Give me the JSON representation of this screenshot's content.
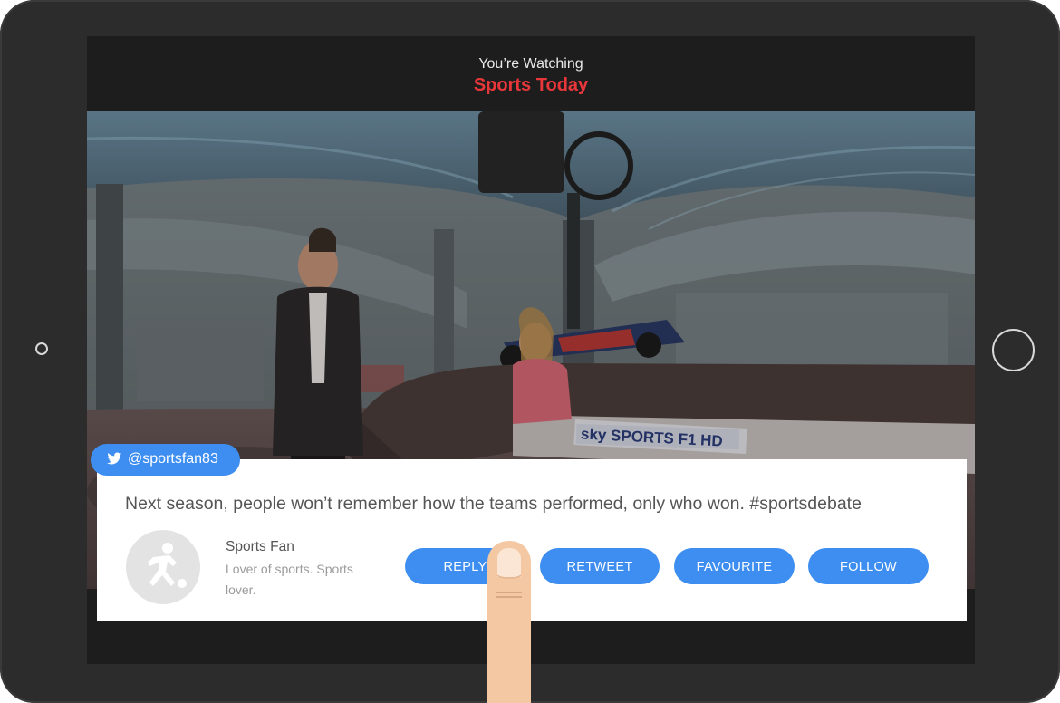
{
  "header": {
    "watching_label": "You’re Watching",
    "show_title": "Sports Today"
  },
  "tweet": {
    "handle": "@sportsfan83",
    "text": "Next season, people won’t remember how the teams performed, only who won. #sportsdebate",
    "user_name": "Sports Fan",
    "user_bio": "Lover of sports. Sports lover."
  },
  "actions": {
    "reply": "REPLY",
    "retweet": "RETWEET",
    "favourite": "FAVOURITE",
    "follow": "FOLLOW"
  },
  "video": {
    "broadcast_logo": "sky SPORTS F1 HD"
  },
  "colors": {
    "accent_red": "#e8373b",
    "button_blue": "#3d8ef0",
    "device_body": "#2c2c2c"
  },
  "icons": {
    "handle_icon": "twitter-bird-icon",
    "avatar_icon": "footballer-silhouette-icon",
    "pointer": "finger-pointer"
  }
}
